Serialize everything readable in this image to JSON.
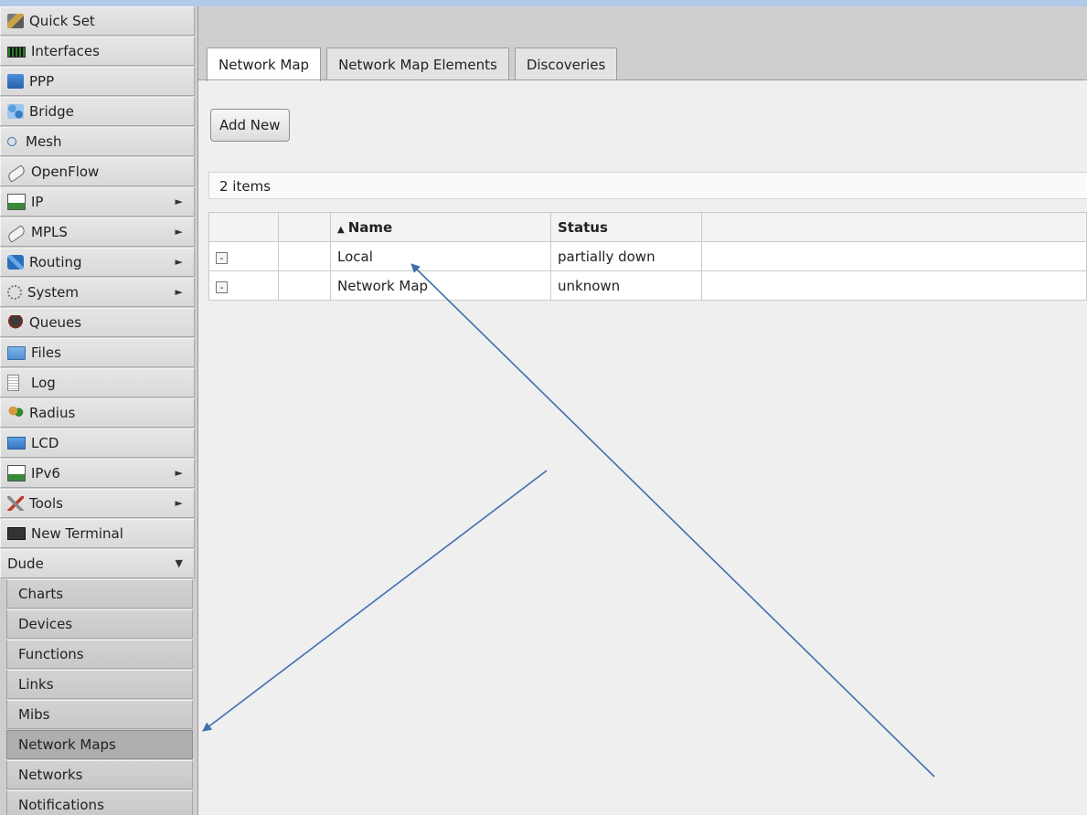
{
  "sidebar": {
    "items": [
      {
        "label": "Quick Set",
        "icon": "quick-set-icon",
        "has_submenu": false
      },
      {
        "label": "Interfaces",
        "icon": "interfaces-icon",
        "has_submenu": false
      },
      {
        "label": "PPP",
        "icon": "ppp-icon",
        "has_submenu": false
      },
      {
        "label": "Bridge",
        "icon": "bridge-icon",
        "has_submenu": false
      },
      {
        "label": "Mesh",
        "icon": "mesh-icon",
        "has_submenu": false
      },
      {
        "label": "OpenFlow",
        "icon": "openflow-icon",
        "has_submenu": false
      },
      {
        "label": "IP",
        "icon": "ip-icon",
        "has_submenu": true
      },
      {
        "label": "MPLS",
        "icon": "mpls-icon",
        "has_submenu": true
      },
      {
        "label": "Routing",
        "icon": "routing-icon",
        "has_submenu": true
      },
      {
        "label": "System",
        "icon": "system-icon",
        "has_submenu": true
      },
      {
        "label": "Queues",
        "icon": "queues-icon",
        "has_submenu": false
      },
      {
        "label": "Files",
        "icon": "files-icon",
        "has_submenu": false
      },
      {
        "label": "Log",
        "icon": "log-icon",
        "has_submenu": false
      },
      {
        "label": "Radius",
        "icon": "radius-icon",
        "has_submenu": false
      },
      {
        "label": "LCD",
        "icon": "lcd-icon",
        "has_submenu": false
      },
      {
        "label": "IPv6",
        "icon": "ipv6-icon",
        "has_submenu": true
      },
      {
        "label": "Tools",
        "icon": "tools-icon",
        "has_submenu": true
      },
      {
        "label": "New Terminal",
        "icon": "terminal-icon",
        "has_submenu": false
      }
    ],
    "expanded": {
      "label": "Dude",
      "arrow": "▼"
    },
    "submenu_arrow": "►",
    "dude_items": [
      {
        "label": "Charts",
        "active": false
      },
      {
        "label": "Devices",
        "active": false
      },
      {
        "label": "Functions",
        "active": false
      },
      {
        "label": "Links",
        "active": false
      },
      {
        "label": "Mibs",
        "active": false
      },
      {
        "label": "Network Maps",
        "active": true
      },
      {
        "label": "Networks",
        "active": false
      },
      {
        "label": "Notifications",
        "active": false
      }
    ]
  },
  "tabs": [
    {
      "label": "Network Map",
      "active": true
    },
    {
      "label": "Network Map Elements",
      "active": false
    },
    {
      "label": "Discoveries",
      "active": false
    }
  ],
  "toolbar": {
    "add_new_label": "Add New"
  },
  "list": {
    "count_text": "2 items",
    "sort_indicator": "▲",
    "columns": [
      "",
      "",
      "Name",
      "Status",
      ""
    ],
    "rows": [
      {
        "button": "-",
        "name": "Local",
        "status": "partially down"
      },
      {
        "button": "-",
        "name": "Network Map",
        "status": "unknown"
      }
    ]
  },
  "colors": {
    "annotation_arrow": "#3f6fad",
    "background": "#b3c9ec"
  }
}
